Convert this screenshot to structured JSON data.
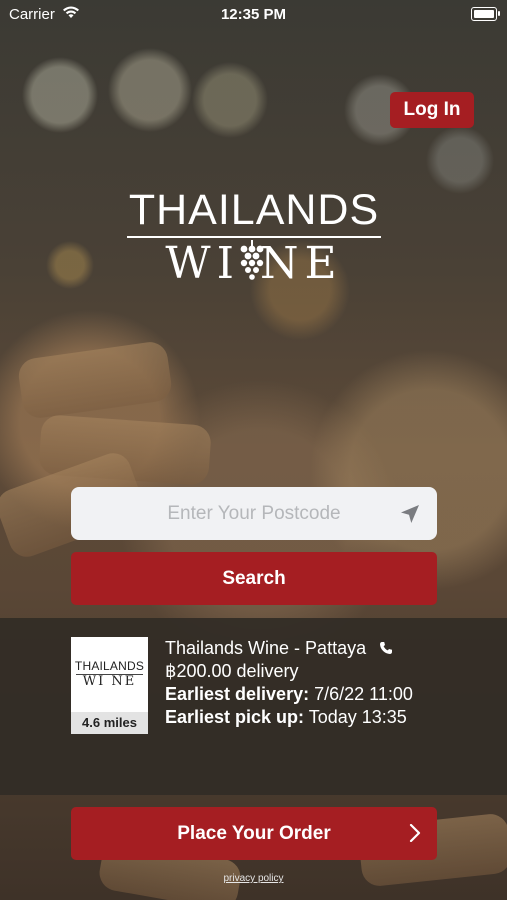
{
  "status_bar": {
    "carrier": "Carrier",
    "time": "12:35 PM"
  },
  "header": {
    "login_label": "Log In"
  },
  "logo": {
    "line1": "THAILANDS",
    "line2": "WI NE"
  },
  "search": {
    "placeholder": "Enter Your Postcode",
    "value": "",
    "button_label": "Search"
  },
  "store": {
    "logo_line1": "THAILANDS",
    "logo_line2": "WI NE",
    "distance": "4.6 miles",
    "name": "Thailands Wine - Pattaya",
    "delivery_fee": "฿200.00 delivery",
    "earliest_delivery_label": "Earliest delivery:",
    "earliest_delivery_value": "7/6/22 11:00",
    "earliest_pickup_label": "Earliest pick up:",
    "earliest_pickup_value": "Today 13:35"
  },
  "order": {
    "button_label": "Place Your Order"
  },
  "footer": {
    "privacy_label": "privacy policy"
  },
  "colors": {
    "accent": "#a51e22",
    "panel": "#322c26",
    "input_bg": "#f1f2f4"
  },
  "icons": [
    "wifi-icon",
    "battery-icon",
    "grape-icon",
    "location-arrow-icon",
    "phone-icon",
    "chevron-right-icon"
  ]
}
